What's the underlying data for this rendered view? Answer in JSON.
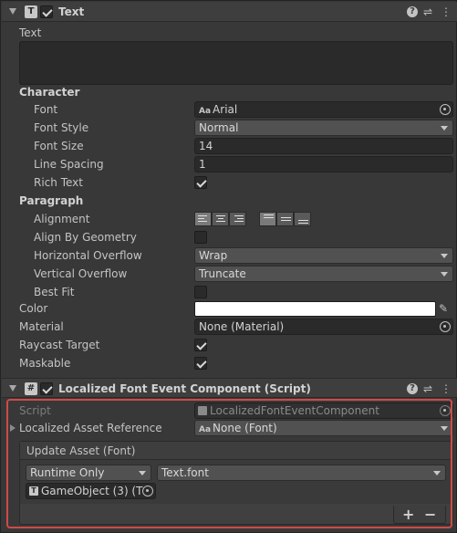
{
  "text_component": {
    "title": "Text",
    "icon_letter": "T",
    "text_label": "Text",
    "text_value": "",
    "character_section": "Character",
    "paragraph_section": "Paragraph",
    "fields": {
      "font_label": "Font",
      "font_value": "Arial",
      "font_icon_text": "Aa",
      "font_style_label": "Font Style",
      "font_style_value": "Normal",
      "font_size_label": "Font Size",
      "font_size_value": "14",
      "line_spacing_label": "Line Spacing",
      "line_spacing_value": "1",
      "rich_text_label": "Rich Text",
      "alignment_label": "Alignment",
      "align_by_geometry_label": "Align By Geometry",
      "horizontal_overflow_label": "Horizontal Overflow",
      "horizontal_overflow_value": "Wrap",
      "vertical_overflow_label": "Vertical Overflow",
      "vertical_overflow_value": "Truncate",
      "best_fit_label": "Best Fit",
      "color_label": "Color",
      "color_value": "#FFFFFF",
      "material_label": "Material",
      "material_value": "None (Material)",
      "raycast_target_label": "Raycast Target",
      "maskable_label": "Maskable"
    },
    "checks": {
      "enabled": true,
      "rich_text": true,
      "align_by_geometry": false,
      "best_fit": false,
      "raycast_target": true,
      "maskable": true
    }
  },
  "localized_component": {
    "title": "Localized Font Event Component (Script)",
    "icon_letter": "#",
    "script_label": "Script",
    "script_value": "LocalizedFontEventComponent",
    "asset_ref_label": "Localized Asset Reference",
    "asset_ref_value": "None (Font)",
    "asset_ref_icon_text": "Aa",
    "event_header": "Update Asset (Font)",
    "runtime_value": "Runtime Only",
    "function_value": "Text.font",
    "target_value": "GameObject (3) (T",
    "add_label": "+",
    "remove_label": "−"
  },
  "colors": {
    "highlight": "#D04A4A",
    "panel": "#383838"
  }
}
